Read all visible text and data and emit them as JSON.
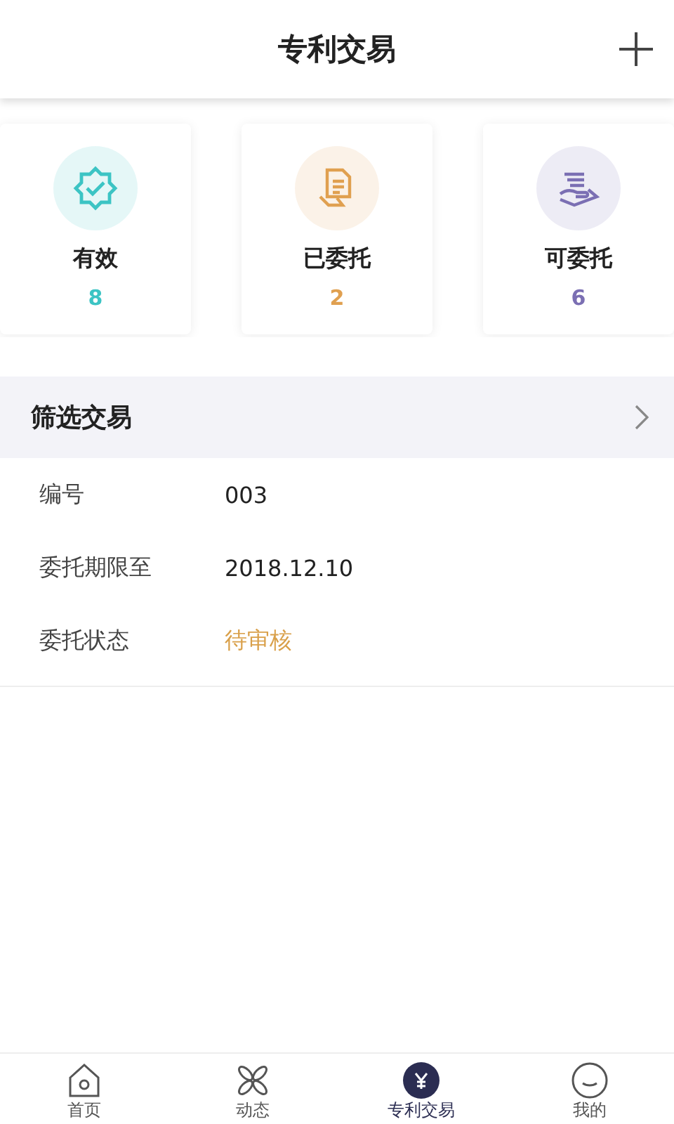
{
  "header": {
    "title": "专利交易"
  },
  "stats": [
    {
      "kind": "valid",
      "label": "有效",
      "count": "8",
      "color": "#3cc4c4"
    },
    {
      "kind": "entrusted",
      "label": "已委托",
      "count": "2",
      "color": "#e0a050"
    },
    {
      "kind": "available",
      "label": "可委托",
      "count": "6",
      "color": "#7b6fb3"
    }
  ],
  "filter": {
    "title": "筛选交易"
  },
  "details": [
    {
      "kind": "plain",
      "label": "编号",
      "value": "003"
    },
    {
      "kind": "plain",
      "label": "委托期限至",
      "value": "2018.12.10"
    },
    {
      "kind": "status",
      "label": "委托状态",
      "value": "待审核"
    }
  ],
  "nav": [
    {
      "kind": "home",
      "label": "首页",
      "selected": false
    },
    {
      "kind": "feed",
      "label": "动态",
      "selected": false
    },
    {
      "kind": "trade",
      "label": "专利交易",
      "selected": true
    },
    {
      "kind": "me",
      "label": "我的",
      "selected": false
    }
  ]
}
